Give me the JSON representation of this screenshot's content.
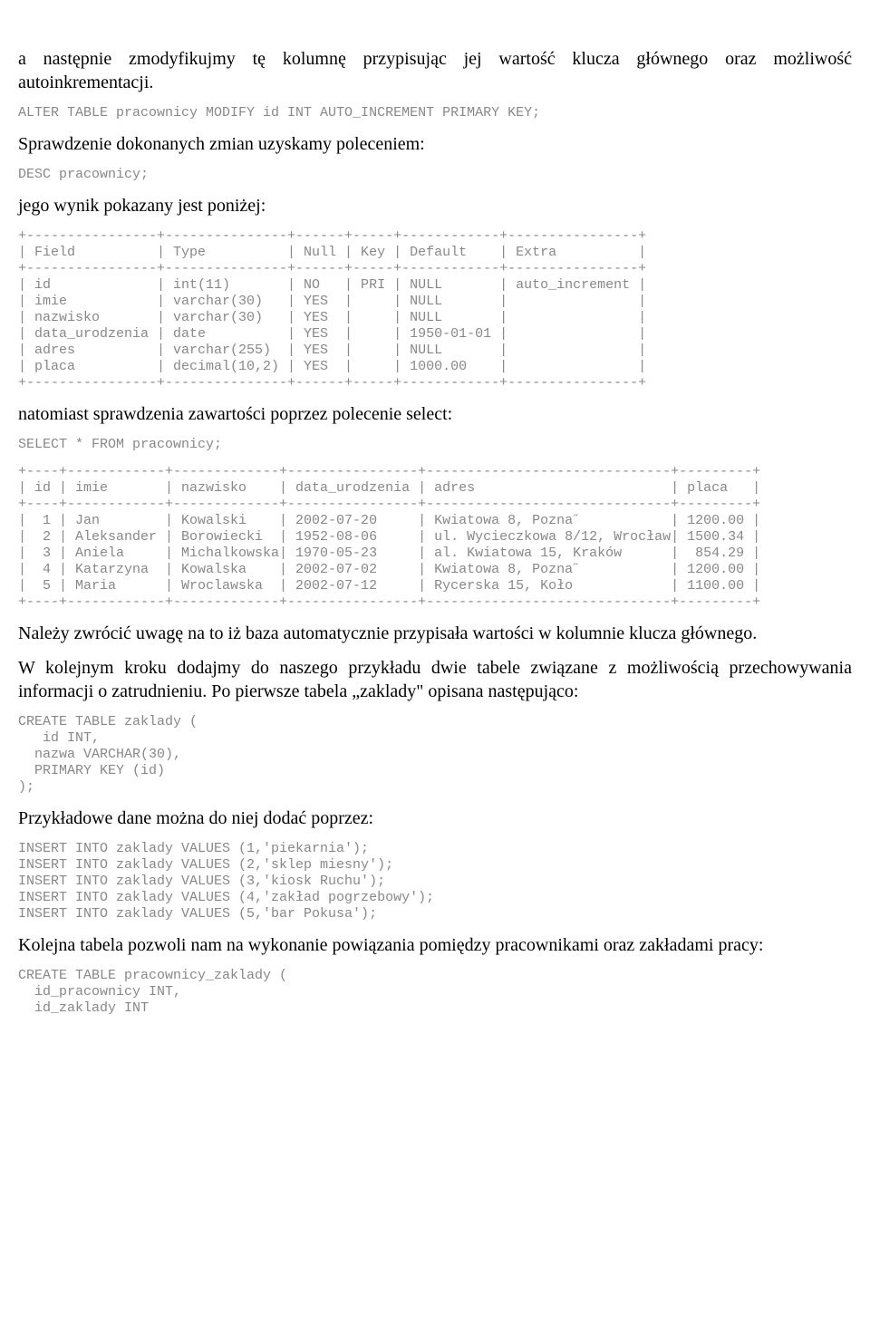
{
  "paragraphs": {
    "p1": "a następnie zmodyfikujmy tę kolumnę przypisując jej wartość klucza głównego oraz możliwość autoinkrementacji.",
    "p2": "Sprawdzenie dokonanych zmian uzyskamy poleceniem:",
    "p3": "jego wynik pokazany jest poniżej:",
    "p4": "natomiast sprawdzenia zawartości poprzez polecenie select:",
    "p5": "Należy zwrócić uwagę na to iż baza automatycznie przypisała wartości w kolumnie klucza głównego.",
    "p6": "W kolejnym kroku dodajmy do naszego przykładu dwie tabele związane z możliwością przechowywania informacji o zatrudnieniu. Po pierwsze tabela „zaklady\" opisana następująco:",
    "p7": "Przykładowe dane można do niej dodać poprzez:",
    "p8": "Kolejna tabela pozwoli nam na wykonanie powiązania pomiędzy pracownikami oraz zakładami pracy:"
  },
  "code": {
    "c1": "ALTER TABLE pracownicy MODIFY id INT AUTO_INCREMENT PRIMARY KEY;",
    "c2": "DESC pracownicy;",
    "c3": "+----------------+---------------+------+-----+------------+----------------+\n| Field          | Type          | Null | Key | Default    | Extra          |\n+----------------+---------------+------+-----+------------+----------------+\n| id             | int(11)       | NO   | PRI | NULL       | auto_increment |\n| imie           | varchar(30)   | YES  |     | NULL       |                |\n| nazwisko       | varchar(30)   | YES  |     | NULL       |                |\n| data_urodzenia | date          | YES  |     | 1950-01-01 |                |\n| adres          | varchar(255)  | YES  |     | NULL       |                |\n| placa          | decimal(10,2) | YES  |     | 1000.00    |                |\n+----------------+---------------+------+-----+------------+----------------+",
    "c4": "SELECT * FROM pracownicy;",
    "c5": "+----+------------+-------------+----------------+------------------------------+---------+\n| id | imie       | nazwisko    | data_urodzenia | adres                        | placa   |\n+----+------------+-------------+----------------+------------------------------+---------+\n|  1 | Jan        | Kowalski    | 2002-07-20     | Kwiatowa 8, Pozna˝           | 1200.00 |\n|  2 | Aleksander | Borowiecki  | 1952-08-06     | ul. Wycieczkowa 8/12, Wrocław| 1500.34 |\n|  3 | Aniela     | Michalkowska| 1970-05-23     | al. Kwiatowa 15, Kraków      |  854.29 |\n|  4 | Katarzyna  | Kowalska    | 2002-07-02     | Kwiatowa 8, Pozna˝           | 1200.00 |\n|  5 | Maria      | Wroclawska  | 2002-07-12     | Rycerska 15, Koło            | 1100.00 |\n+----+------------+-------------+----------------+------------------------------+---------+",
    "c6": "CREATE TABLE zaklady (\n   id INT,\n  nazwa VARCHAR(30),\n  PRIMARY KEY (id)\n);",
    "c7": "INSERT INTO zaklady VALUES (1,'piekarnia');\nINSERT INTO zaklady VALUES (2,'sklep miesny');\nINSERT INTO zaklady VALUES (3,'kiosk Ruchu');\nINSERT INTO zaklady VALUES (4,'zakład pogrzebowy');\nINSERT INTO zaklady VALUES (5,'bar Pokusa');",
    "c8": "CREATE TABLE pracownicy_zaklady (\n  id_pracownicy INT,\n  id_zaklady INT"
  }
}
